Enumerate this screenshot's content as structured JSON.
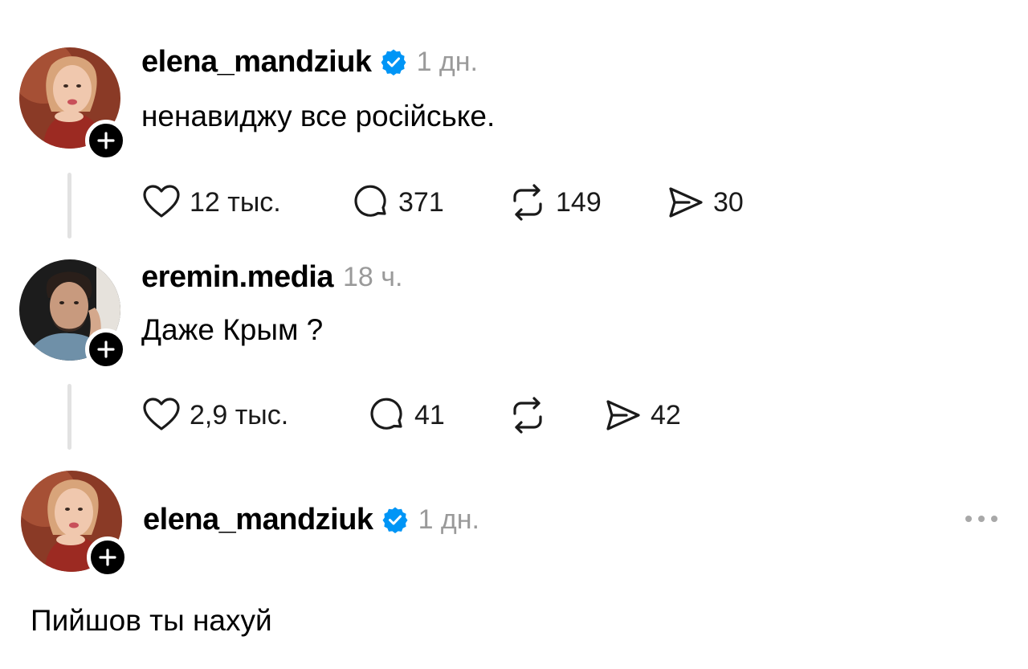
{
  "posts": [
    {
      "username": "elena_mandziuk",
      "verified": true,
      "time": "1 дн.",
      "text": "ненавиджу все російське.",
      "actions": {
        "likes": "12 тыс.",
        "replies": "371",
        "reposts": "149",
        "shares": "30"
      }
    },
    {
      "username": "eremin.media",
      "verified": false,
      "time": "18 ч.",
      "text": "Даже Крым ?",
      "actions": {
        "likes": "2,9 тыс.",
        "replies": "41",
        "reposts": "",
        "shares": "42"
      }
    },
    {
      "username": "elena_mandziuk",
      "verified": true,
      "time": "1 дн.",
      "text": "Пийшов ты нахуй"
    }
  ],
  "icons": {
    "like": "heart-icon",
    "reply": "speech-bubble-icon",
    "repost": "repost-arrows-icon",
    "share": "paper-plane-icon",
    "verified": "verified-badge-icon",
    "follow": "plus-icon",
    "more": "ellipsis-icon"
  },
  "colors": {
    "verified": "#0095f6",
    "muted": "#9a9a9a",
    "thread_line": "#e2e2e2"
  }
}
